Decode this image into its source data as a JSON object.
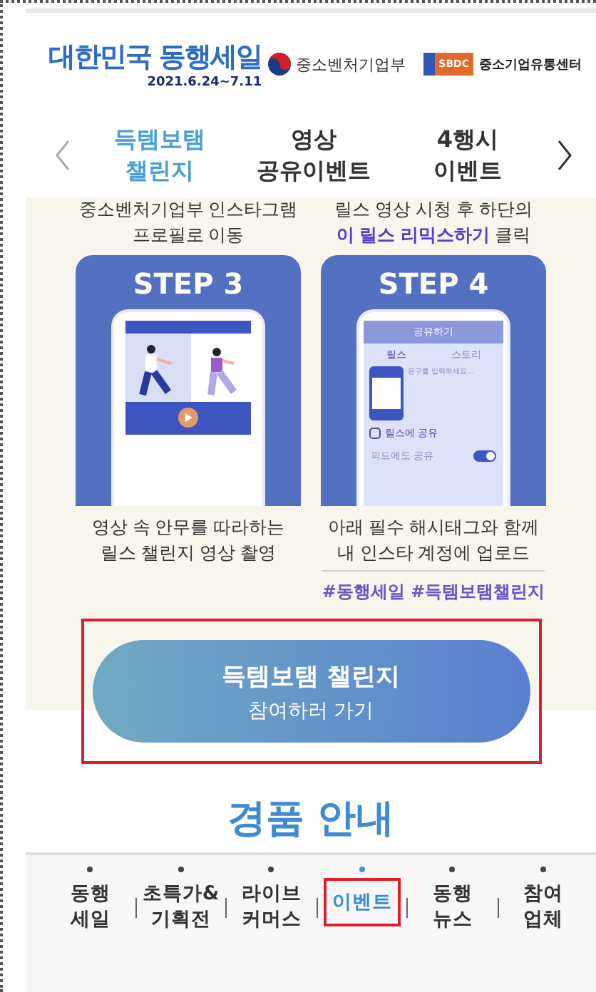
{
  "header": {
    "logo": {
      "title": "대한민국 동행세일",
      "dates": "2021.6.24~7.11"
    },
    "ministry": "중소벤처기업부",
    "sbdc": {
      "badge": "SBDC",
      "name": "중소기업유통센터"
    }
  },
  "tabs": [
    {
      "label": "득템보탬\n챌린지",
      "selected": true
    },
    {
      "label": "영상\n공유이벤트",
      "selected": false
    },
    {
      "label": "4행시\n이벤트",
      "selected": false
    }
  ],
  "top_captions": [
    {
      "line1": "중소벤처기업부 인스타그램",
      "line2": "프로필로 이동"
    },
    {
      "line1": "릴스 영상 시청 후 하단의",
      "line2": "**이 릴스 리믹스하기** 클릭"
    }
  ],
  "steps": [
    {
      "kind": "dance",
      "title": "STEP 3",
      "caption": "영상 속 안무를 따라하는\n릴스 챌린지 영상 촬영"
    },
    {
      "kind": "share",
      "title": "STEP 4",
      "screen": {
        "title": "공유하기",
        "tab_1": "릴스",
        "tab_2": "스토리",
        "input": "문구를 입력하세요...",
        "share": "릴스에 공유",
        "feed": "피드에도 공유",
        "feed_on": true
      },
      "caption": "아래 필수 해시태그와 함께\n내 인스타 계정에 업로드"
    }
  ],
  "hashtags": "#동행세일 #득템보탬챌린지",
  "cta": {
    "title": "득템보탬 챌린지",
    "subtitle": "참여하러 가기",
    "highlighted": true
  },
  "prizes_heading": "경품 안내",
  "nav": [
    {
      "label": "동행\n세일",
      "selected": false
    },
    {
      "label": "초특가&\n기획전",
      "selected": false
    },
    {
      "label": "라이브\n커머스",
      "selected": false
    },
    {
      "label": "이벤트",
      "selected": true
    },
    {
      "label": "동행\n뉴스",
      "selected": false
    },
    {
      "label": "참여\n업체",
      "selected": false
    }
  ]
}
